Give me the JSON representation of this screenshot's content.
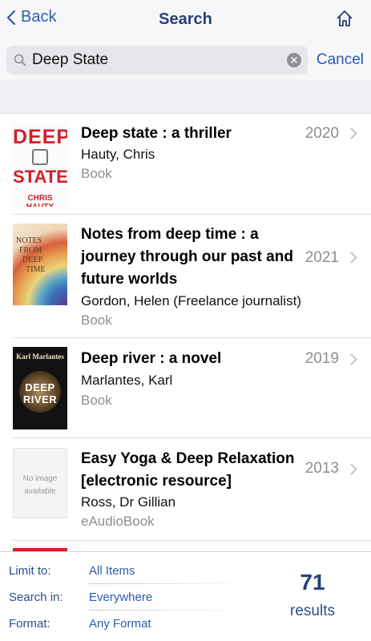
{
  "nav": {
    "back_label": "Back",
    "title": "Search"
  },
  "search": {
    "query": "Deep State",
    "cancel_label": "Cancel"
  },
  "results": [
    {
      "title_lines": [
        "Deep state : a thriller"
      ],
      "author": "Hauty, Chris",
      "format": "Book",
      "year": "2020",
      "cover": {
        "top": "DEEP",
        "bottom": "STATE",
        "author": "CHRIS HAUTY"
      }
    },
    {
      "title_lines": [
        "Notes from deep time : a",
        "journey through our past and",
        "future worlds"
      ],
      "author": "Gordon, Helen (Freelance journalist)",
      "format": "Book",
      "year": "2021",
      "cover": {
        "text": [
          "NOTES",
          "FROM",
          "DEEP",
          "TIME"
        ]
      }
    },
    {
      "title_lines": [
        "Deep river : a novel"
      ],
      "author": "Marlantes, Karl",
      "format": "Book",
      "year": "2019",
      "cover": {
        "author": "Karl Marlantes",
        "text": [
          "DEEP",
          "RIVER"
        ]
      }
    },
    {
      "title_lines": [
        "Easy Yoga & Deep Relaxation",
        "[electronic resource]"
      ],
      "author": "Ross, Dr Gillian",
      "format": "eAudioBook",
      "year": "2013",
      "cover": {
        "text": [
          "No image",
          "available"
        ]
      }
    }
  ],
  "footer": {
    "limit_label": "Limit to:",
    "limit_value": "All Items",
    "search_in_label": "Search in:",
    "search_in_value": "Everywhere",
    "format_label": "Format:",
    "format_value": "Any Format",
    "result_count": "71",
    "results_label": "results"
  },
  "colors": {
    "accent": "#2a5cad",
    "title": "#263f7a",
    "muted": "#8e8e93"
  }
}
